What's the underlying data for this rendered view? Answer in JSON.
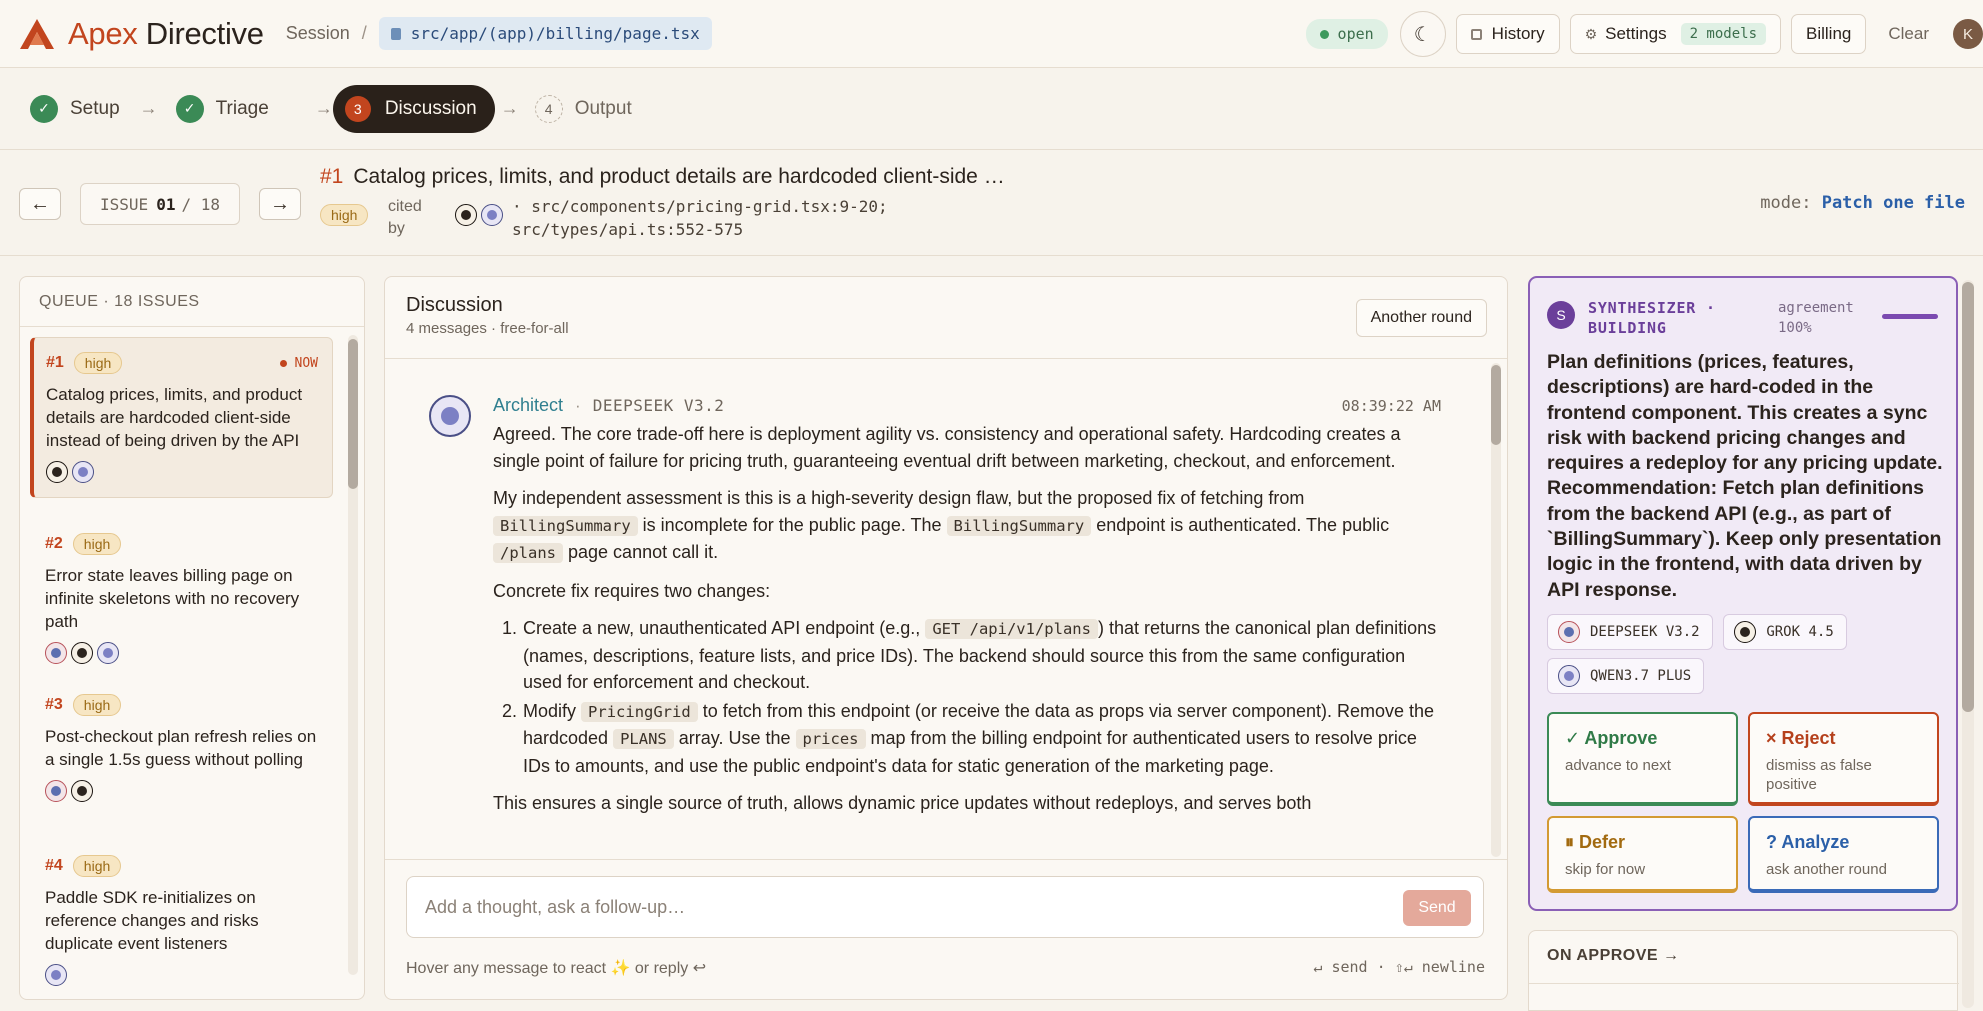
{
  "app": {
    "brand_first": "Apex",
    "brand_second": "Directive",
    "crumb": "Session",
    "crumb_sep": "/",
    "path": "src/app/(app)/billing/page.tsx",
    "status": "open",
    "history_label": "History",
    "settings_label": "Settings",
    "models_badge": "2 models",
    "billing_label": "Billing",
    "clear_label": "Clear",
    "user_initial": "K"
  },
  "stepper": {
    "steps": [
      {
        "label": "Setup",
        "state": "done"
      },
      {
        "label": "Triage",
        "state": "done"
      },
      {
        "label": "Discussion",
        "state": "active",
        "num": "3"
      },
      {
        "label": "Output",
        "state": "pending",
        "num": "4"
      }
    ]
  },
  "issue": {
    "counter_prefix": "ISSUE",
    "counter_current": "01",
    "counter_total": "/ 18",
    "hash": "#1",
    "title": "Catalog prices, limits, and product details are hardcoded client-side …",
    "severity": "high",
    "cited_by": "cited by",
    "files_line1": "· src/components/pricing-grid.tsx:9-20;",
    "files_line2": "src/types/api.ts:552-575",
    "mode_label": "mode:",
    "mode_value": "Patch one file"
  },
  "queue": {
    "title": "QUEUE · 18 ISSUES",
    "now_label": "NOW",
    "items": [
      {
        "num": "#1",
        "severity": "high",
        "text": "Catalog prices, limits, and product details are hardcoded client-side instead of being driven by the API"
      },
      {
        "num": "#2",
        "severity": "high",
        "text": "Error state leaves billing page on infinite skeletons with no recovery path"
      },
      {
        "num": "#3",
        "severity": "high",
        "text": "Post-checkout plan refresh relies on a single 1.5s guess without polling"
      },
      {
        "num": "#4",
        "severity": "high",
        "text": "Paddle SDK re-initializes on reference changes and risks duplicate event listeners"
      }
    ]
  },
  "discussion": {
    "title": "Discussion",
    "meta": "4 messages  ·  free-for-all",
    "another_round": "Another round",
    "message": {
      "author": "Architect",
      "sep": "·",
      "model": "DEEPSEEK V3.2",
      "time": "08:39:22 AM",
      "p1": "Agreed. The core trade-off here is deployment agility vs. consistency and operational safety. Hardcoding creates a single point of failure for pricing truth, guaranteeing eventual drift between marketing, checkout, and enforcement.",
      "p2a": "My independent assessment is this is a high-severity design flaw, but the proposed fix of fetching from",
      "p2_code1": "BillingSummary",
      "p2b": "is incomplete for the public page. The",
      "p2_code2": "BillingSummary",
      "p2c": "endpoint is authenticated. The public",
      "p2_code3": "/plans",
      "p2d": "page cannot call it.",
      "p3": "Concrete fix requires two changes:",
      "li1_num": "1.",
      "li1a": "Create a new, unauthenticated API endpoint (e.g.,",
      "li1_code": "GET /api/v1/plans",
      "li1b": ") that returns the canonical plan definitions (names, descriptions, feature lists, and price IDs). The backend should source this from the same configuration used for enforcement and checkout.",
      "li2_num": "2.",
      "li2a": "Modify",
      "li2_code1": "PricingGrid",
      "li2b": "to fetch from this endpoint (or receive the data as props via server component). Remove the hardcoded",
      "li2_code2": "PLANS",
      "li2c": "array. Use the",
      "li2_code3": "prices",
      "li2d": "map from the billing endpoint for authenticated users to resolve price IDs to amounts, and use the public endpoint's data for static generation of the marketing page.",
      "p4": "This ensures a single source of truth, allows dynamic price updates without redeploys, and serves both"
    },
    "composer": {
      "placeholder": "Add a thought, ask a follow-up…",
      "send": "Send",
      "hint": "Hover any message to react ✨ or reply ↩",
      "keys": "↵ send  ·  ⇧↵ newline"
    }
  },
  "synth": {
    "badge": "S",
    "label": "SYNTHESIZER · BUILDING",
    "agreement_label": "agreement",
    "agreement_value": "100%",
    "agreement_fraction": 1.0,
    "text": "Plan definitions (prices, features, descriptions) are hard-coded in the frontend component. This creates a sync risk with backend pricing changes and requires a redeploy for any pricing update. Recommendation: Fetch plan definitions from the backend API (e.g., as part of `BillingSummary`). Keep only presentation logic in the frontend, with data driven by API response.",
    "models": [
      "DEEPSEEK V3.2",
      "GROK 4.5",
      "QWEN3.7 PLUS"
    ],
    "actions": {
      "approve": {
        "title": "✓ Approve",
        "sub": "advance to next"
      },
      "reject": {
        "title": "× Reject",
        "sub": "dismiss as false positive"
      },
      "defer": {
        "title": "⏸ Defer",
        "sub": "skip for now"
      },
      "analyze": {
        "title": "? Analyze",
        "sub": "ask another round"
      }
    }
  },
  "on_approve": {
    "title": "ON APPROVE →"
  },
  "colors": {
    "accent": "#c2451e",
    "success": "#3b8a56",
    "synth_purple": "#8a5fb6",
    "info_blue": "#2b5fa8",
    "warning": "#d39a33"
  }
}
